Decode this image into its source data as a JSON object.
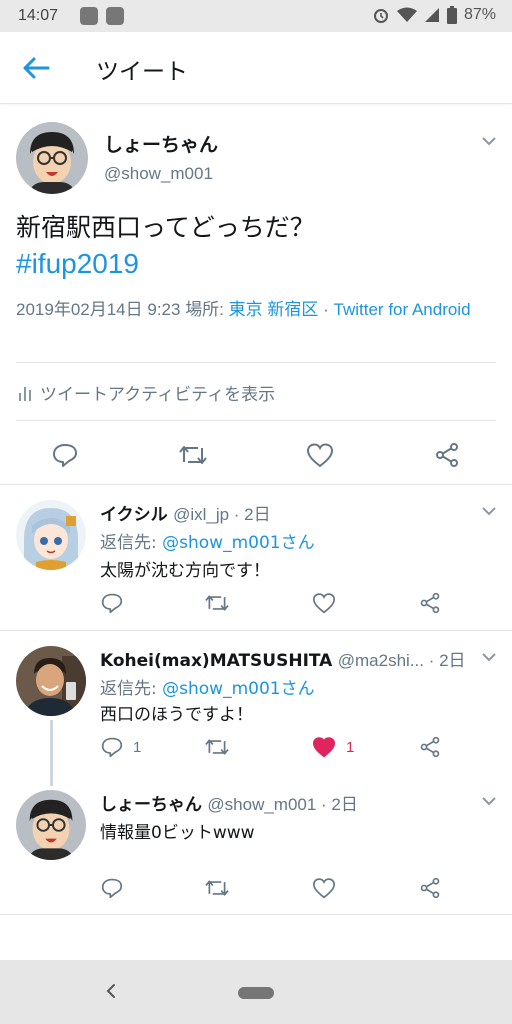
{
  "status_bar": {
    "time": "14:07",
    "battery": "87%",
    "icons": [
      "line-app-icon",
      "news-app-icon",
      "alarm-icon",
      "wifi-icon",
      "signal-icon",
      "battery-icon"
    ]
  },
  "app_bar": {
    "title": "ツイート",
    "back_icon": "arrow-left-icon"
  },
  "tweet": {
    "author_name": "しょーちゃん",
    "author_handle": "@show_m001",
    "text": "新宿駅西口ってどっちだ？",
    "hashtag": "#ifup2019",
    "timestamp": "2019年02月14日 9:23",
    "location_label": "場所:",
    "location": "東京 新宿区",
    "separator": "·",
    "source": "Twitter for Android",
    "activity_label": "ツイートアクティビティを表示"
  },
  "replies": [
    {
      "name": "イクシル",
      "handle": "@ixl_jp · 2日",
      "reply_to_label": "返信先:",
      "reply_to_user": "@show_m001さん",
      "text": "太陽が沈む方向です！",
      "reply_count": "",
      "like_count": "",
      "liked": false
    },
    {
      "name": "Kohei(max)MATSUSHITA",
      "handle": "@ma2shi... · 2日",
      "reply_to_label": "返信先:",
      "reply_to_user": "@show_m001さん",
      "text": "西口のほうですよ！",
      "reply_count": "1",
      "like_count": "1",
      "liked": true
    },
    {
      "name": "しょーちゃん",
      "handle": "@show_m001 · 2日",
      "text": "情報量0ビットwww",
      "reply_count": "",
      "like_count": "",
      "liked": false
    }
  ],
  "colors": {
    "link": "#1b95e0",
    "secondary_text": "#657786",
    "like_active": "#e0245e",
    "divider": "#e3e5e8"
  }
}
